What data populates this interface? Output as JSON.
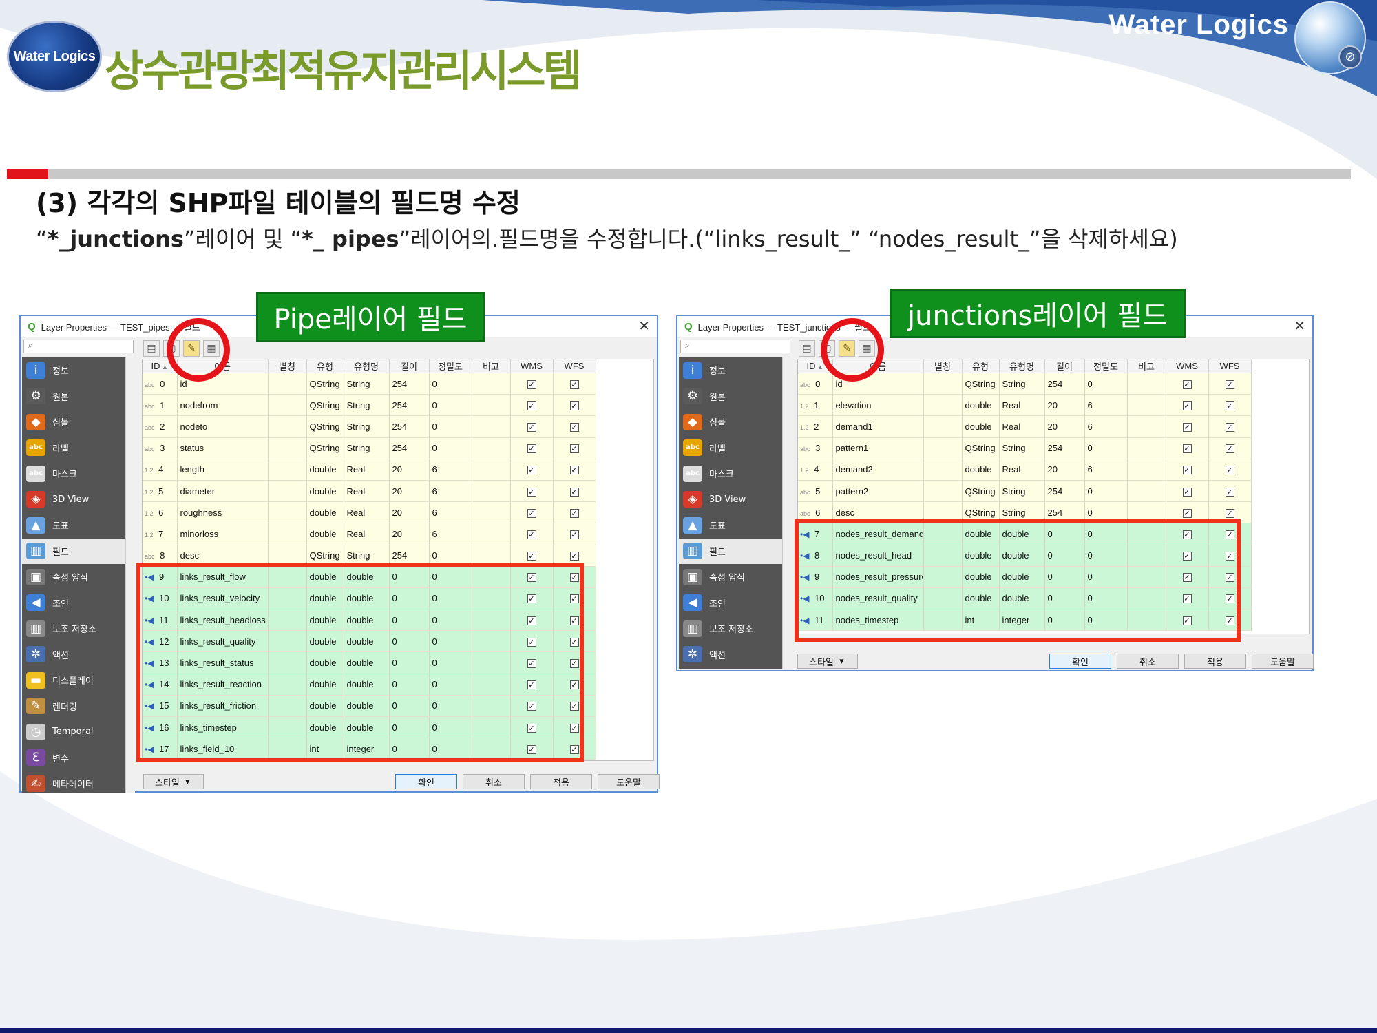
{
  "header": {
    "logo_text": "Water Logics",
    "system_title": "상수관망최적유지관리시스템",
    "brand_name": "Water Logics",
    "compass_glyph": "⊘"
  },
  "section": {
    "heading": "(3) 각각의 SHP파일 테이블의 필드명 수정",
    "desc_q1_open": "“",
    "desc_junctions": "*_junctions",
    "desc_q1_close": "”레이어 및 “",
    "desc_pipes": "*_ pipes",
    "desc_rest": "”레이어의.필드명을 수정합니다.(“links_result_” “nodes_result_”을 삭제하세요)"
  },
  "colors": {
    "title_green": "#7a9a2c",
    "label_green": "#0f8f1c",
    "highlight_red": "#f0321a",
    "row_yellow": "#fefee2",
    "row_green": "#ccf7d6"
  },
  "labels": {
    "pipe": "Pipe레이어 필드",
    "junctions": "junctions레이어 필드"
  },
  "dialog_common": {
    "q_icon": "Q",
    "close_glyph": "✕",
    "search_glyph": "⌕",
    "sort_glyph": "▲",
    "check_glyph": "✓",
    "headers": [
      "ID",
      "이름",
      "별칭",
      "유형",
      "유형명",
      "길이",
      "정밀도",
      "비고",
      "WMS",
      "WFS"
    ],
    "toolbar_icons": [
      "new-field-icon",
      "delete-field-icon",
      "edit-pencil-icon",
      "field-calculator-icon"
    ],
    "toolbar_glyphs": [
      "▤",
      "▢",
      "✎",
      "▦"
    ],
    "sidebar": [
      {
        "label": "정보",
        "icon": "info-icon",
        "glyph": "i"
      },
      {
        "label": "원본",
        "icon": "source-wrench-icon",
        "glyph": "⚙"
      },
      {
        "label": "심볼",
        "icon": "symbology-brush-icon",
        "glyph": "◆"
      },
      {
        "label": "라벨",
        "icon": "labels-abc-icon",
        "glyph": "abc"
      },
      {
        "label": "마스크",
        "icon": "mask-abc-icon",
        "glyph": "abc"
      },
      {
        "label": "3D View",
        "icon": "3d-cube-icon",
        "glyph": "◈"
      },
      {
        "label": "도표",
        "icon": "diagram-icon",
        "glyph": "▲"
      },
      {
        "label": "필드",
        "icon": "fields-table-icon",
        "glyph": "▥"
      },
      {
        "label": "속성 양식",
        "icon": "attributes-form-icon",
        "glyph": "▣"
      },
      {
        "label": "조인",
        "icon": "join-icon",
        "glyph": "◀"
      },
      {
        "label": "보조 저장소",
        "icon": "auxiliary-storage-icon",
        "glyph": "▥"
      },
      {
        "label": "액션",
        "icon": "actions-gear-icon",
        "glyph": "✲"
      },
      {
        "label": "디스플레이",
        "icon": "display-bubble-icon",
        "glyph": "▬"
      },
      {
        "label": "렌더링",
        "icon": "rendering-brush-icon",
        "glyph": "✎"
      },
      {
        "label": "Temporal",
        "icon": "temporal-clock-icon",
        "glyph": "◷"
      },
      {
        "label": "변수",
        "icon": "variables-icon",
        "glyph": "ℇ"
      },
      {
        "label": "메타데이터",
        "icon": "metadata-icon",
        "glyph": "✍"
      }
    ],
    "buttons": {
      "style": "스타일",
      "ok": "확인",
      "cancel": "취소",
      "apply": "적용",
      "help": "도움말"
    },
    "style_caret": "▾"
  },
  "pipes_dialog": {
    "title": "Layer Properties — TEST_pipes — 필드",
    "rows": [
      {
        "t": "abc",
        "id": "0",
        "name": "id",
        "type": "QString",
        "tname": "String",
        "len": "254",
        "prec": "0",
        "g": false
      },
      {
        "t": "abc",
        "id": "1",
        "name": "nodefrom",
        "type": "QString",
        "tname": "String",
        "len": "254",
        "prec": "0",
        "g": false
      },
      {
        "t": "abc",
        "id": "2",
        "name": "nodeto",
        "type": "QString",
        "tname": "String",
        "len": "254",
        "prec": "0",
        "g": false
      },
      {
        "t": "abc",
        "id": "3",
        "name": "status",
        "type": "QString",
        "tname": "String",
        "len": "254",
        "prec": "0",
        "g": false
      },
      {
        "t": "1.2",
        "id": "4",
        "name": "length",
        "type": "double",
        "tname": "Real",
        "len": "20",
        "prec": "6",
        "g": false
      },
      {
        "t": "1.2",
        "id": "5",
        "name": "diameter",
        "type": "double",
        "tname": "Real",
        "len": "20",
        "prec": "6",
        "g": false
      },
      {
        "t": "1.2",
        "id": "6",
        "name": "roughness",
        "type": "double",
        "tname": "Real",
        "len": "20",
        "prec": "6",
        "g": false
      },
      {
        "t": "1.2",
        "id": "7",
        "name": "minorloss",
        "type": "double",
        "tname": "Real",
        "len": "20",
        "prec": "6",
        "g": false
      },
      {
        "t": "abc",
        "id": "8",
        "name": "desc",
        "type": "QString",
        "tname": "String",
        "len": "254",
        "prec": "0",
        "g": false
      },
      {
        "t": "•◀",
        "id": "9",
        "name": "links_result_flow",
        "type": "double",
        "tname": "double",
        "len": "0",
        "prec": "0",
        "g": true
      },
      {
        "t": "•◀",
        "id": "10",
        "name": "links_result_velocity",
        "type": "double",
        "tname": "double",
        "len": "0",
        "prec": "0",
        "g": true
      },
      {
        "t": "•◀",
        "id": "11",
        "name": "links_result_headloss",
        "type": "double",
        "tname": "double",
        "len": "0",
        "prec": "0",
        "g": true
      },
      {
        "t": "•◀",
        "id": "12",
        "name": "links_result_quality",
        "type": "double",
        "tname": "double",
        "len": "0",
        "prec": "0",
        "g": true
      },
      {
        "t": "•◀",
        "id": "13",
        "name": "links_result_status",
        "type": "double",
        "tname": "double",
        "len": "0",
        "prec": "0",
        "g": true
      },
      {
        "t": "•◀",
        "id": "14",
        "name": "links_result_reaction",
        "type": "double",
        "tname": "double",
        "len": "0",
        "prec": "0",
        "g": true
      },
      {
        "t": "•◀",
        "id": "15",
        "name": "links_result_friction",
        "type": "double",
        "tname": "double",
        "len": "0",
        "prec": "0",
        "g": true
      },
      {
        "t": "•◀",
        "id": "16",
        "name": "links_timestep",
        "type": "double",
        "tname": "double",
        "len": "0",
        "prec": "0",
        "g": true
      },
      {
        "t": "•◀",
        "id": "17",
        "name": "links_field_10",
        "type": "int",
        "tname": "integer",
        "len": "0",
        "prec": "0",
        "g": true
      }
    ]
  },
  "junctions_dialog": {
    "title": "Layer Properties — TEST_junctions — 필드",
    "rows": [
      {
        "t": "abc",
        "id": "0",
        "name": "id",
        "type": "QString",
        "tname": "String",
        "len": "254",
        "prec": "0",
        "g": false
      },
      {
        "t": "1.2",
        "id": "1",
        "name": "elevation",
        "type": "double",
        "tname": "Real",
        "len": "20",
        "prec": "6",
        "g": false
      },
      {
        "t": "1.2",
        "id": "2",
        "name": "demand1",
        "type": "double",
        "tname": "Real",
        "len": "20",
        "prec": "6",
        "g": false
      },
      {
        "t": "abc",
        "id": "3",
        "name": "pattern1",
        "type": "QString",
        "tname": "String",
        "len": "254",
        "prec": "0",
        "g": false
      },
      {
        "t": "1.2",
        "id": "4",
        "name": "demand2",
        "type": "double",
        "tname": "Real",
        "len": "20",
        "prec": "6",
        "g": false
      },
      {
        "t": "abc",
        "id": "5",
        "name": "pattern2",
        "type": "QString",
        "tname": "String",
        "len": "254",
        "prec": "0",
        "g": false
      },
      {
        "t": "abc",
        "id": "6",
        "name": "desc",
        "type": "QString",
        "tname": "String",
        "len": "254",
        "prec": "0",
        "g": false
      },
      {
        "t": "•◀",
        "id": "7",
        "name": "nodes_result_demand",
        "type": "double",
        "tname": "double",
        "len": "0",
        "prec": "0",
        "g": true
      },
      {
        "t": "•◀",
        "id": "8",
        "name": "nodes_result_head",
        "type": "double",
        "tname": "double",
        "len": "0",
        "prec": "0",
        "g": true
      },
      {
        "t": "•◀",
        "id": "9",
        "name": "nodes_result_pressure",
        "type": "double",
        "tname": "double",
        "len": "0",
        "prec": "0",
        "g": true
      },
      {
        "t": "•◀",
        "id": "10",
        "name": "nodes_result_quality",
        "type": "double",
        "tname": "double",
        "len": "0",
        "prec": "0",
        "g": true
      },
      {
        "t": "•◀",
        "id": "11",
        "name": "nodes_timestep",
        "type": "int",
        "tname": "integer",
        "len": "0",
        "prec": "0",
        "g": true
      }
    ]
  }
}
